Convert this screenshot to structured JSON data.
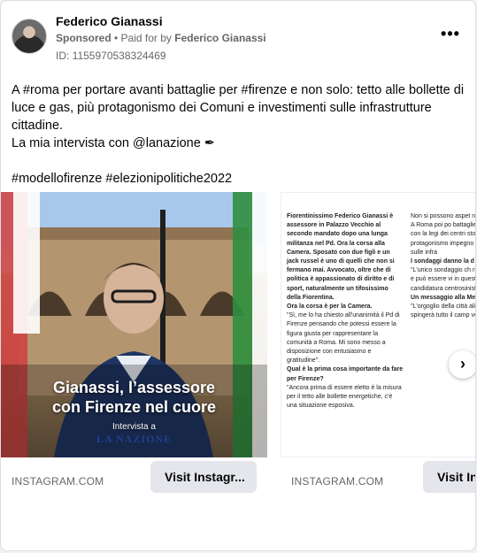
{
  "post": {
    "author": "Federico Gianassi",
    "sponsored": "Sponsored",
    "paid_for_prefix": " • Paid for by ",
    "paid_for_name": "Federico Gianassi",
    "ad_id": "ID: 1155970538324469",
    "more_label": "•••",
    "text_line1": "A #roma per portare avanti battaglie per #firenze e non solo: tetto alle bollette di luce e gas, più protagonismo dei Comuni e investimenti sulle infrastrutture cittadine.",
    "text_line2": "La mia intervista con @lanazione ✒",
    "hashtags": "#modellofirenze #elezionipolitiche2022"
  },
  "carousel": {
    "slides": [
      {
        "overlay_title_1": "Gianassi, l’assessore",
        "overlay_title_2": "con Firenze nel cuore",
        "overlay_sub": "Intervista a",
        "overlay_brand": "LA NAZIONE",
        "caption": "INSTAGRAM.COM",
        "cta": "Visit Instagr..."
      },
      {
        "col1": [
          {
            "t": "Fiorentinissimo Federico Gianassi è assessore in Palazzo Vecchio al secondo mandato dopo una lunga militanza nel Pd. Ora la corsa alla Camera. Sposato con due figli e un jack russel è uno di quelli che non si fermano mai. Avvocato, oltre che di politica è appassionato di diritto e di sport, naturalmente un tifosissimo della Fiorentina.",
            "b": true
          },
          {
            "t": "Ora la corsa è per la Camera.",
            "b": true
          },
          {
            "t": "\"Sì, me lo ha chiesto all'unanimità il Pd di Firenze pensando che potessi essere la figura giusta per rappresentare la comunità a Roma. Mi sono messo a disposizione con entusiasmo e gratitudine\".",
            "b": false
          },
          {
            "t": "Qual è la prima cosa importante da fare per Firenze?",
            "b": true
          },
          {
            "t": "\"Ancora prima di essere eletto è la misura per il tetto alle bollette energetiche, c'è una situazione esposiva.",
            "b": false
          }
        ],
        "col2": [
          {
            "t": "Non si possono aspet nuovo governo bisogr subito. A Roma poi po battaglie care alla citt dell'identità con la legi dei centri storici e le ruolo e protagonismo impegno massimo per investimenti sulle infra",
            "b": false
          },
          {
            "t": "I sondaggi danno la d vincente.",
            "b": true
          },
          {
            "t": "\"L'unico sondaggio ch risultato a urne chiuse a zero e può essere vi in questi primi giorni, consenso e s candidatura centrosinist",
            "b": false
          },
          {
            "t": "Un messaggio alla Me",
            "b": true
          },
          {
            "t": "\"L'orgoglio della città alimenta di cultura de spingerà tutto il camp verso il miglior risultat",
            "b": false
          }
        ],
        "caption": "INSTAGRAM.COM",
        "cta": "Visit Ins"
      }
    ],
    "next_icon": "›"
  }
}
